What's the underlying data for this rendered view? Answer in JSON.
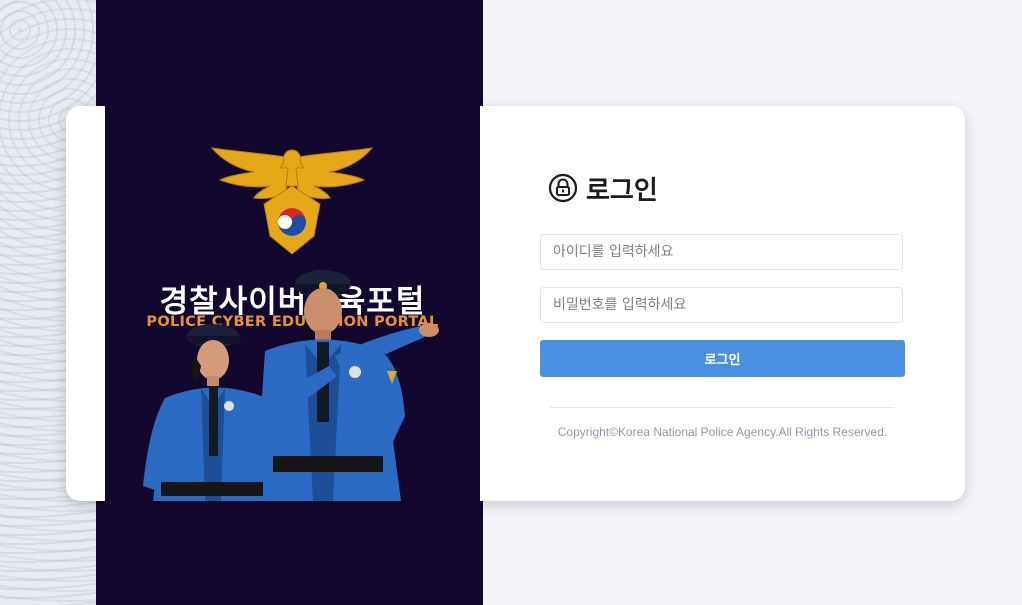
{
  "brand": {
    "portal_title": "경찰사이버교육포털",
    "portal_subtitle": "POLICE CYBER EDUCATION PORTAL",
    "emblem_icon": "police-eagle-emblem",
    "colors": {
      "navy": "#12082f",
      "gold": "#e8a915",
      "subtitle_orange": "#e8932e"
    }
  },
  "login": {
    "title": "로그인",
    "lock_icon": "lock-icon",
    "id_placeholder": "아이디를 입력하세요",
    "password_placeholder": "비밀번호를 입력하세요",
    "submit_label": "로그인",
    "button_color": "#4a90e2"
  },
  "footer": {
    "copyright": "Copyright©Korea National Police Agency.All Rights Reserved."
  }
}
